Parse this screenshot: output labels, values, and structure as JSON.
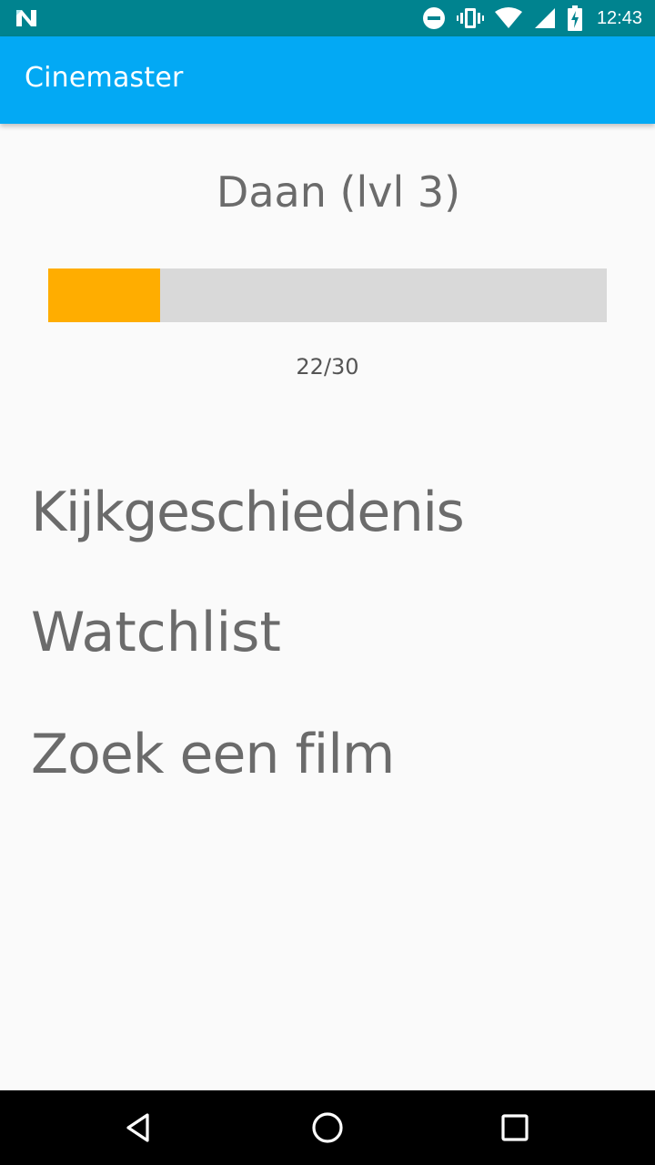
{
  "status_bar": {
    "time": "12:43",
    "icons": [
      "n-logo-icon",
      "do-not-disturb-icon",
      "vibrate-icon",
      "wifi-icon",
      "signal-icon",
      "battery-charging-icon"
    ],
    "background": "#00838f"
  },
  "app_bar": {
    "title": "Cinemaster",
    "background": "#03a9f4"
  },
  "profile": {
    "name_level": "Daan (lvl 3)",
    "progress": {
      "current": 22,
      "total": 30,
      "label": "22/30",
      "fill_color": "#ffad00",
      "track_color": "#d9d9d9"
    }
  },
  "menu": {
    "items": [
      {
        "label": "Kijkgeschiedenis"
      },
      {
        "label": "Watchlist"
      },
      {
        "label": "Zoek een film"
      }
    ]
  },
  "nav_bar": {
    "buttons": [
      "back-icon",
      "home-icon",
      "recents-icon"
    ]
  }
}
